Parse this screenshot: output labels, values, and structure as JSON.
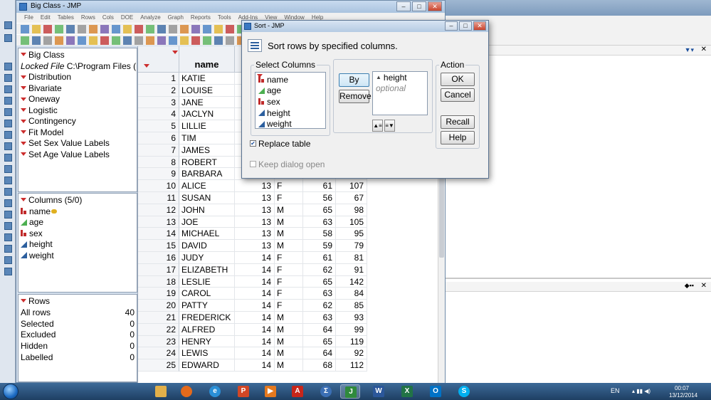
{
  "main_window": {
    "title": "Big Class - JMP",
    "menu": [
      "File",
      "Edit",
      "Tables",
      "Rows",
      "Cols",
      "DOE",
      "Analyze",
      "Graph",
      "Reports",
      "Tools",
      "Add-Ins",
      "View",
      "Window",
      "Help"
    ]
  },
  "table_panel": {
    "title": "Big Class",
    "locked_prefix": "Locked File",
    "locked_path": "C:\\Program Files (",
    "scripts": [
      "Distribution",
      "Bivariate",
      "Oneway",
      "Logistic",
      "Contingency",
      "Fit Model",
      "Set Sex Value Labels",
      "Set Age Value Labels"
    ]
  },
  "columns_panel": {
    "title": "Columns (5/0)",
    "items": [
      {
        "name": "name",
        "type": "nominal"
      },
      {
        "name": "age",
        "type": "ordinal"
      },
      {
        "name": "sex",
        "type": "nominal"
      },
      {
        "name": "height",
        "type": "continuous"
      },
      {
        "name": "weight",
        "type": "continuous"
      }
    ]
  },
  "rows_panel": {
    "title": "Rows",
    "stats": [
      {
        "label": "All rows",
        "value": "40"
      },
      {
        "label": "Selected",
        "value": "0"
      },
      {
        "label": "Excluded",
        "value": "0"
      },
      {
        "label": "Hidden",
        "value": "0"
      },
      {
        "label": "Labelled",
        "value": "0"
      }
    ]
  },
  "grid": {
    "header_name": "name",
    "rows": [
      {
        "n": "1",
        "name": "KATIE",
        "age": "",
        "sex": "",
        "height": "",
        "weight": ""
      },
      {
        "n": "2",
        "name": "LOUISE",
        "age": "",
        "sex": "",
        "height": "",
        "weight": ""
      },
      {
        "n": "3",
        "name": "JANE",
        "age": "",
        "sex": "",
        "height": "",
        "weight": ""
      },
      {
        "n": "4",
        "name": "JACLYN",
        "age": "",
        "sex": "",
        "height": "",
        "weight": ""
      },
      {
        "n": "5",
        "name": "LILLIE",
        "age": "",
        "sex": "",
        "height": "",
        "weight": ""
      },
      {
        "n": "6",
        "name": "TIM",
        "age": "",
        "sex": "",
        "height": "",
        "weight": ""
      },
      {
        "n": "7",
        "name": "JAMES",
        "age": "",
        "sex": "",
        "height": "",
        "weight": ""
      },
      {
        "n": "8",
        "name": "ROBERT",
        "age": "",
        "sex": "",
        "height": "",
        "weight": ""
      },
      {
        "n": "9",
        "name": "BARBARA",
        "age": "",
        "sex": "",
        "height": "",
        "weight": ""
      },
      {
        "n": "10",
        "name": "ALICE",
        "age": "13",
        "sex": "F",
        "height": "61",
        "weight": "107"
      },
      {
        "n": "11",
        "name": "SUSAN",
        "age": "13",
        "sex": "F",
        "height": "56",
        "weight": "67"
      },
      {
        "n": "12",
        "name": "JOHN",
        "age": "13",
        "sex": "M",
        "height": "65",
        "weight": "98"
      },
      {
        "n": "13",
        "name": "JOE",
        "age": "13",
        "sex": "M",
        "height": "63",
        "weight": "105"
      },
      {
        "n": "14",
        "name": "MICHAEL",
        "age": "13",
        "sex": "M",
        "height": "58",
        "weight": "95"
      },
      {
        "n": "15",
        "name": "DAVID",
        "age": "13",
        "sex": "M",
        "height": "59",
        "weight": "79"
      },
      {
        "n": "16",
        "name": "JUDY",
        "age": "14",
        "sex": "F",
        "height": "61",
        "weight": "81"
      },
      {
        "n": "17",
        "name": "ELIZABETH",
        "age": "14",
        "sex": "F",
        "height": "62",
        "weight": "91"
      },
      {
        "n": "18",
        "name": "LESLIE",
        "age": "14",
        "sex": "F",
        "height": "65",
        "weight": "142"
      },
      {
        "n": "19",
        "name": "CAROL",
        "age": "14",
        "sex": "F",
        "height": "63",
        "weight": "84"
      },
      {
        "n": "20",
        "name": "PATTY",
        "age": "14",
        "sex": "F",
        "height": "62",
        "weight": "85"
      },
      {
        "n": "21",
        "name": "FREDERICK",
        "age": "14",
        "sex": "M",
        "height": "63",
        "weight": "93"
      },
      {
        "n": "22",
        "name": "ALFRED",
        "age": "14",
        "sex": "M",
        "height": "64",
        "weight": "99"
      },
      {
        "n": "23",
        "name": "HENRY",
        "age": "14",
        "sex": "M",
        "height": "65",
        "weight": "119"
      },
      {
        "n": "24",
        "name": "LEWIS",
        "age": "14",
        "sex": "M",
        "height": "64",
        "weight": "92"
      },
      {
        "n": "25",
        "name": "EDWARD",
        "age": "14",
        "sex": "M",
        "height": "68",
        "weight": "112"
      }
    ]
  },
  "sort_dialog": {
    "title": "Sort - JMP",
    "description": "Sort rows by specified columns.",
    "select_columns_label": "Select Columns",
    "columns": [
      {
        "name": "name",
        "type": "nominal"
      },
      {
        "name": "age",
        "type": "ordinal"
      },
      {
        "name": "sex",
        "type": "nominal"
      },
      {
        "name": "height",
        "type": "continuous"
      },
      {
        "name": "weight",
        "type": "continuous"
      }
    ],
    "by_label": "By",
    "remove_label": "Remove",
    "by_column": "height",
    "optional_placeholder": "optional",
    "action_label": "Action",
    "ok_label": "OK",
    "cancel_label": "Cancel",
    "recall_label": "Recall",
    "help_label": "Help",
    "replace_table_label": "Replace table",
    "replace_table_checked": true,
    "keep_open_label": "Keep dialog open",
    "keep_open_checked": false
  },
  "tray": {
    "lang": "EN",
    "time": "00:07",
    "date": "13/12/2014"
  },
  "colors": {
    "nominal": "#c02b2b",
    "ordinal": "#4caf50",
    "continuous": "#2c5f9e",
    "accent": "#3c7fb1"
  }
}
